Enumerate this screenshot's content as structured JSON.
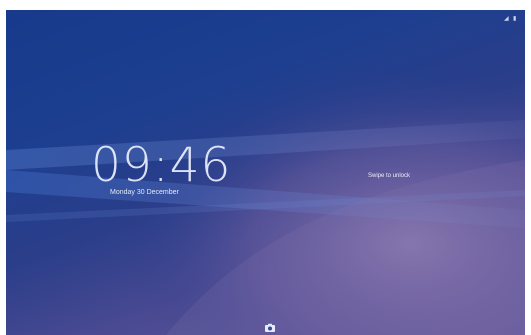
{
  "lockscreen": {
    "time": "09:46",
    "date": "Monday 30 December",
    "unlock_hint": "Swipe to unlock"
  },
  "icons": {
    "camera": "camera-icon",
    "signal": "signal-icon",
    "battery": "battery-icon"
  },
  "colors": {
    "wallpaper_top": "#173a8c",
    "wallpaper_bottom": "#6e5f9e",
    "text": "#ebf0ff"
  }
}
